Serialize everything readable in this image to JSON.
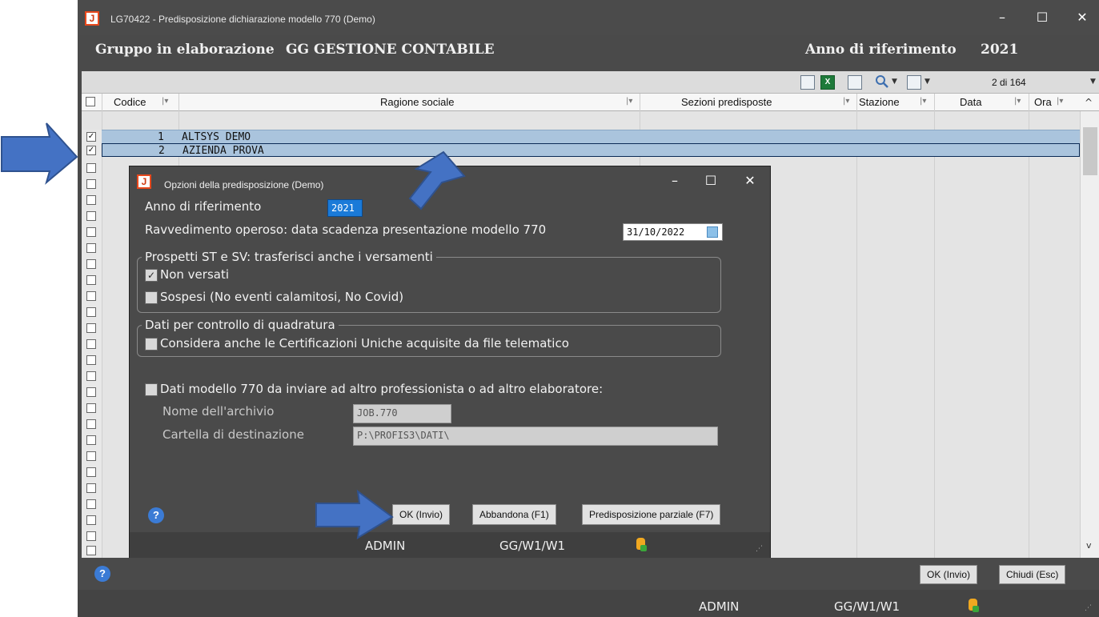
{
  "window": {
    "title": "LG70422 - Predisposizione dichiarazione modello 770 (Demo)",
    "app_icon": "J"
  },
  "header": {
    "group_label": "Gruppo in elaborazione",
    "group_value": "GG GESTIONE CONTABILE",
    "year_label": "Anno di riferimento",
    "year_value": "2021"
  },
  "toolbar": {
    "count": "2 di 164",
    "excel_icon": "X"
  },
  "grid": {
    "columns": [
      "Codice",
      "Ragione sociale",
      "Sezioni predisposte",
      "Stazione",
      "Data",
      "Ora"
    ],
    "rows": [
      {
        "checked": true,
        "code": "1",
        "name": "ALTSYS DEMO"
      },
      {
        "checked": true,
        "code": "2",
        "name": "AZIENDA PROVA"
      }
    ]
  },
  "dialog": {
    "title": "Opzioni della predisposizione  (Demo)",
    "year_label": "Anno di riferimento",
    "year_value": "2021",
    "ravv_label": "Ravvedimento operoso: data scadenza presentazione modello 770",
    "ravv_value": "31/10/2022",
    "group1_title": "Prospetti ST e SV: trasferisci anche i versamenti",
    "non_versati_label": "Non versati",
    "non_versati_checked": true,
    "sospesi_label": "Sospesi (No eventi calamitosi, No Covid)",
    "sospesi_checked": false,
    "group2_title": "Dati per controllo di quadratura",
    "certificazioni_label": "Considera anche le Certificazioni Uniche acquisite da file telematico",
    "certificazioni_checked": false,
    "altro_label": "Dati modello 770 da inviare ad altro professionista o ad altro elaboratore:",
    "altro_checked": false,
    "archivio_label": "Nome dell'archivio",
    "archivio_value": "JOB.770",
    "cartella_label": "Cartella di destinazione",
    "cartella_value": "P:\\PROFIS3\\DATI\\",
    "ok_label": "OK (Invio)",
    "abbandona_label": "Abbandona (F1)",
    "parziale_label": "Predisposizione parziale (F7)",
    "status_user": "ADMIN",
    "status_station": "GG/W1/W1",
    "help": "?"
  },
  "bottom": {
    "help": "?",
    "ok_label": "OK (Invio)",
    "chiudi_label": "Chiudi (Esc)",
    "status_user": "ADMIN",
    "status_station": "GG/W1/W1"
  },
  "colors": {
    "accent": "#4472c4",
    "selection": "#aac4dd",
    "dark_bg": "#4a4a4a"
  }
}
